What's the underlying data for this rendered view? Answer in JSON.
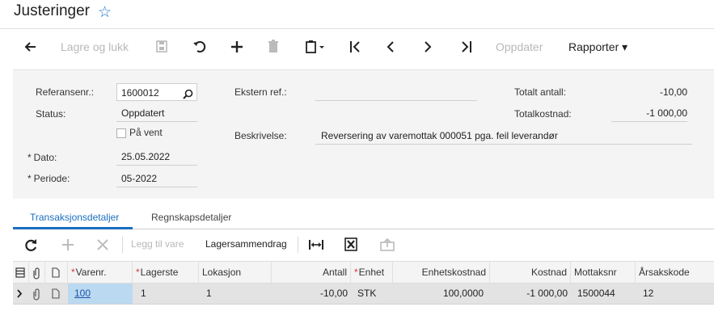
{
  "header": {
    "title": "Justeringer"
  },
  "toolbar": {
    "save_close_label": "Lagre og lukk",
    "update_label": "Oppdater",
    "reports_label": "Rapporter ▾"
  },
  "form": {
    "ref_label": "Referansenr.:",
    "ref_value": "1600012",
    "status_label": "Status:",
    "status_value": "Oppdatert",
    "hold_label": "På vent",
    "date_label": "Dato:",
    "date_value": "25.05.2022",
    "period_label": "Periode:",
    "period_value": "05-2022",
    "ext_ref_label": "Ekstern ref.:",
    "ext_ref_value": "",
    "desc_label": "Beskrivelse:",
    "desc_value": "Reversering av varemottak 000051 pga. feil leverandør",
    "total_qty_label": "Totalt antall:",
    "total_qty_value": "-10,00",
    "total_cost_label": "Totalkostnad:",
    "total_cost_value": "-1 000,00",
    "required_mark": "*"
  },
  "tabs": [
    {
      "label": "Transaksjonsdetaljer",
      "active": true
    },
    {
      "label": "Regnskapsdetaljer",
      "active": false
    }
  ],
  "grid_toolbar": {
    "add_item_label": "Legg til vare",
    "inventory_summary_label": "Lagersammendrag"
  },
  "grid": {
    "columns": [
      {
        "label": "Varenr.",
        "required": true
      },
      {
        "label": "Lagerste",
        "required": true
      },
      {
        "label": "Lokasjon",
        "required": false
      },
      {
        "label": "Antall",
        "required": false
      },
      {
        "label": "Enhet",
        "required": true
      },
      {
        "label": "Enhetskostnad",
        "required": false
      },
      {
        "label": "Kostnad",
        "required": false
      },
      {
        "label": "Mottaksnr",
        "required": false
      },
      {
        "label": "Årsakskode",
        "required": false
      }
    ],
    "rows": [
      {
        "item": "100",
        "warehouse": "1",
        "location": "1",
        "qty": "-10,00",
        "uom": "STK",
        "unit_cost": "100,0000",
        "cost": "-1 000,00",
        "receipt": "1500044",
        "reason": "12"
      }
    ]
  },
  "colors": {
    "accent": "#1a6fc2",
    "required": "#d9363e",
    "selected_cell": "#bcd9f2"
  }
}
